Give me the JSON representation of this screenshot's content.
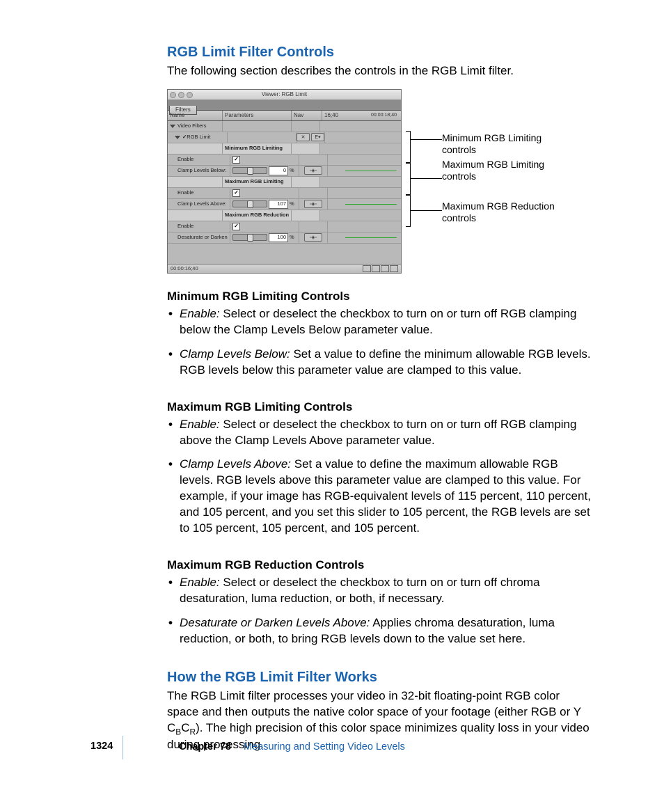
{
  "headings": {
    "h1": "RGB Limit Filter Controls",
    "h1_intro": "The following section describes the controls in the RGB Limit filter.",
    "h2": "How the RGB Limit Filter Works"
  },
  "screenshot": {
    "title": "Viewer: RGB Limit",
    "tab": "Filters",
    "cols": {
      "name": "Name",
      "param": "Parameters",
      "nav": "Nav"
    },
    "timecode_left": "16;40",
    "timecode_right": "00:00:18;40",
    "status_tc": "00:00:16;40",
    "rows": {
      "video_filters": "Video Filters",
      "rgb_limit": "RGB Limit",
      "min_section": "Minimum RGB Limiting",
      "enable": "Enable",
      "clamp_below": "Clamp Levels Below:",
      "max_section": "Maximum RGB Limiting",
      "clamp_above": "Clamp Levels Above:",
      "red_section": "Maximum RGB Reduction",
      "desat": "Desaturate or Darken"
    },
    "vals": {
      "below": "0",
      "above": "107",
      "desat": "100"
    }
  },
  "annots": {
    "min": "Minimum RGB Limiting controls",
    "max": "Maximum RGB Limiting controls",
    "red": "Maximum RGB Reduction controls"
  },
  "sections": {
    "min": {
      "title": "Minimum RGB Limiting Controls",
      "b1_label": "Enable:",
      "b1_text": "  Select or deselect the checkbox to turn on or turn off RGB clamping below the Clamp Levels Below parameter value.",
      "b2_label": "Clamp Levels Below:",
      "b2_text": "  Set a value to define the minimum allowable RGB levels. RGB levels below this parameter value are clamped to this value."
    },
    "max": {
      "title": "Maximum RGB Limiting Controls",
      "b1_label": "Enable:",
      "b1_text": "  Select or deselect the checkbox to turn on or turn off RGB clamping above the Clamp Levels Above parameter value.",
      "b2_label": "Clamp Levels Above:",
      "b2_text": "  Set a value to define the maximum allowable RGB levels. RGB levels above this parameter value are clamped to this value. For example, if your image has RGB-equivalent levels of 115 percent, 110 percent, and 105 percent, and you set this slider to 105 percent, the RGB levels are set to 105 percent, 105 percent, and 105 percent."
    },
    "red": {
      "title": "Maximum RGB Reduction Controls",
      "b1_label": "Enable:",
      "b1_text": "  Select or deselect the checkbox to turn on or turn off chroma desaturation, luma reduction, or both, if necessary.",
      "b2_label": "Desaturate or Darken Levels Above:",
      "b2_text": "  Applies chroma desaturation, luma reduction, or both, to bring RGB levels down to the value set here."
    }
  },
  "how_works": {
    "p_pre": "The RGB Limit filter processes your video in 32-bit floating-point RGB color space and then outputs the native color space of your footage (either RGB or Y C",
    "sub1": "B",
    "mid": "C",
    "sub2": "R",
    "p_post": "). The high precision of this color space minimizes quality loss in your video during processing."
  },
  "footer": {
    "page": "1324",
    "chapter": "Chapter 78",
    "title": "Measuring and Setting Video Levels"
  }
}
